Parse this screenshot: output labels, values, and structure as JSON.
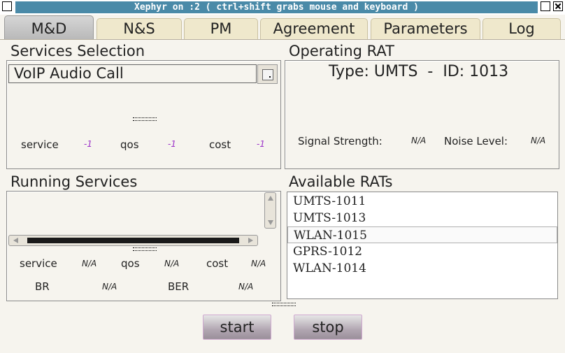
{
  "window": {
    "title": "Xephyr on :2 ( ctrl+shift grabs mouse and keyboard )"
  },
  "tabs": [
    {
      "label": "M&D",
      "active": true
    },
    {
      "label": "N&S",
      "active": false
    },
    {
      "label": "PM",
      "active": false
    },
    {
      "label": "Agreement",
      "active": false
    },
    {
      "label": "Parameters",
      "active": false
    },
    {
      "label": "Log",
      "active": false
    }
  ],
  "services_selection": {
    "title": "Services Selection",
    "selected_service": "VoIP Audio Call",
    "service_label": "service",
    "service_value": "-1",
    "qos_label": "qos",
    "qos_value": "-1",
    "cost_label": "cost",
    "cost_value": "-1"
  },
  "operating_rat": {
    "title": "Operating RAT",
    "type_line": "Type: UMTS  -  ID: 1013",
    "signal_label": "Signal Strength:",
    "signal_value": "N/A",
    "noise_label": "Noise Level:",
    "noise_value": "N/A"
  },
  "running_services": {
    "title": "Running Services",
    "service_label": "service",
    "service_value": "N/A",
    "qos_label": "qos",
    "qos_value": "N/A",
    "cost_label": "cost",
    "cost_value": "N/A",
    "br_label": "BR",
    "br_value": "N/A",
    "ber_label": "BER",
    "ber_value": "N/A"
  },
  "available_rats": {
    "title": "Available RATs",
    "items": [
      "UMTS-1011",
      "UMTS-1013",
      "WLAN-1015",
      "GPRS-1012",
      "WLAN-1014"
    ],
    "selected_index": 2
  },
  "buttons": {
    "start": "start",
    "stop": "stop"
  },
  "colors": {
    "title_bar": "#4a8aa8",
    "value_accent": "#9b30c8"
  }
}
